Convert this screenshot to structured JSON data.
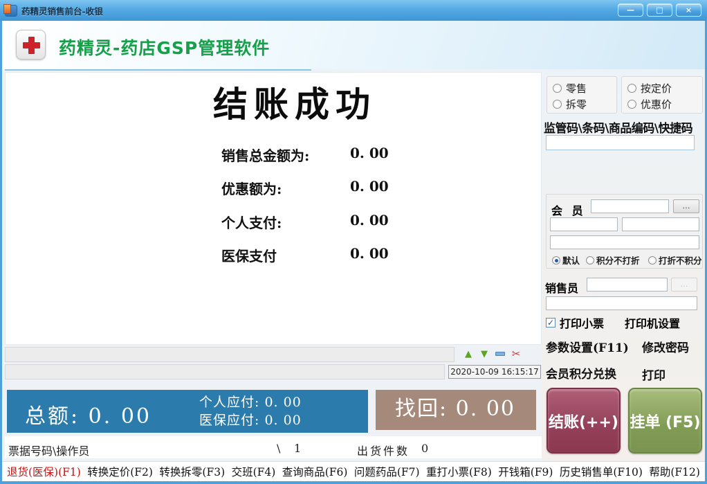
{
  "colors": {
    "titlebar_blue": "#4aa0dc",
    "brand_green": "#16a04a",
    "cross_red": "#ce2129",
    "totals_blue": "#2b7cac",
    "change_taupe": "#a5897b",
    "checkout_maroon": "#94405a",
    "hold_green": "#819c55",
    "hotkey_red": "#cc1111"
  },
  "window": {
    "title": "药精灵销售前台-收银",
    "minimize_glyph": "—",
    "maximize_glyph": "□",
    "close_glyph": "×"
  },
  "header": {
    "app_title": "药精灵-药店GSP管理软件"
  },
  "main": {
    "heading": "结账成功",
    "rows": [
      {
        "label": "销售总金额为:",
        "value": "0. 00"
      },
      {
        "label": "优惠额为:",
        "value": "0. 00"
      },
      {
        "label": "个人支付:",
        "value": "0. 00"
      },
      {
        "label": "医保支付",
        "value": "0. 00"
      }
    ]
  },
  "right_panel": {
    "price_modes": [
      {
        "label": "零售",
        "selected": false
      },
      {
        "label": "拆零",
        "selected": false
      },
      {
        "label": "按定价",
        "selected": false
      },
      {
        "label": "优惠价",
        "selected": false
      }
    ],
    "barcode_label": "监管码\\条码\\商品编码\\快捷码",
    "barcode_input_value": "",
    "member": {
      "label": "会 员",
      "more_glyph": "…",
      "input_value": "",
      "discount_modes": [
        {
          "label": "默认",
          "selected": true
        },
        {
          "label": "积分不打折",
          "selected": false
        },
        {
          "label": "打折不积分",
          "selected": false
        }
      ]
    },
    "salesperson_label": "销售员",
    "salesperson_more_glyph": "…",
    "print_receipt_label": "打印小票",
    "print_receipt_checked": true,
    "check_glyph": "✓",
    "printer_settings_label": "打印机设置",
    "links": {
      "params": "参数设置(F11)",
      "change_password": "修改密码",
      "points_exchange": "会员积分兑换",
      "print": "打印"
    },
    "checkout_button": "结账(++)",
    "hold_button": "挂单 (F5)"
  },
  "statusbar": {
    "up_glyph": "▲",
    "down_glyph": "▼",
    "cut_glyph": "✂",
    "timestamp": "2020-10-09 16:15:17"
  },
  "totals": {
    "total_label": "总额:",
    "total_value": "0. 00",
    "personal_label": "个人应付:",
    "personal_value": "0. 00",
    "insurance_label": "医保应付:",
    "insurance_value": "0. 00",
    "change_label": "找回:",
    "change_value": "0. 00"
  },
  "receipt_row": {
    "left": "票据号码\\操作员",
    "slash": "\\",
    "count": "1",
    "shipped_label": "出货件数",
    "shipped_value": "0"
  },
  "function_bar": {
    "items": [
      {
        "label": "退货(医保)(F1)",
        "red": true
      },
      {
        "label": "转换定价(F2)",
        "red": false
      },
      {
        "label": "转换拆零(F3)",
        "red": false
      },
      {
        "label": "交班(F4)",
        "red": false
      },
      {
        "label": "查询商品(F6)",
        "red": false
      },
      {
        "label": "问题药品(F7)",
        "red": false
      },
      {
        "label": "重打小票(F8)",
        "red": false
      },
      {
        "label": "开钱箱(F9)",
        "red": false
      },
      {
        "label": "历史销售单(F10)",
        "red": false
      },
      {
        "label": "帮助(F12)",
        "red": false
      }
    ]
  }
}
